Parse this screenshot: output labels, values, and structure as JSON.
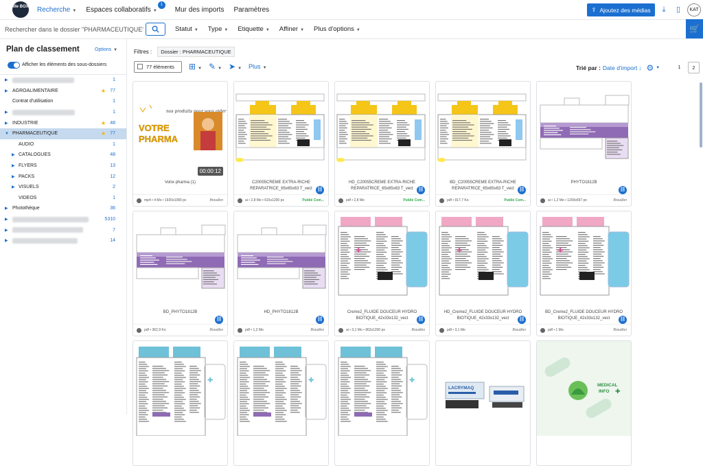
{
  "topnav": {
    "logo_text": "file BOX",
    "items": [
      {
        "label": "Recherche",
        "active": true,
        "caret": true
      },
      {
        "label": "Espaces collaboratifs",
        "active": false,
        "caret": true,
        "badge": "1"
      },
      {
        "label": "Mur des imports",
        "active": false,
        "caret": false
      },
      {
        "label": "Paramètres",
        "active": false,
        "caret": false
      }
    ],
    "add_media_label": "Ajoutez des médias",
    "avatar": "KAT",
    "accent_color": "#1b6fd0"
  },
  "searchbar": {
    "placeholder": "Rechercher dans le dossier \"PHARMACEUTIQUE\"",
    "filters": [
      "Statut",
      "Type",
      "Etiquette",
      "Affiner",
      "Plus d'options"
    ]
  },
  "sidebar": {
    "title": "Plan de classement",
    "options_label": "Options",
    "toggle_label": "Afficher les éléments des sous-dossiers",
    "nodes": [
      {
        "label": "",
        "count": "1",
        "blur": true,
        "arrow": true,
        "indent": 0
      },
      {
        "label": "AGROALIMENTAIRE",
        "count": "77",
        "star": true,
        "arrow": true,
        "indent": 0
      },
      {
        "label": "Contrat d'utilisation",
        "count": "1",
        "indent": 0
      },
      {
        "label": "",
        "count": "1",
        "blur": true,
        "arrow": true,
        "indent": 0
      },
      {
        "label": "INDUSTRIE",
        "count": "48",
        "star": true,
        "arrow": true,
        "indent": 0
      },
      {
        "label": "PHARMACEUTIQUE",
        "count": "77",
        "star": true,
        "arrow": true,
        "open": true,
        "selected": true,
        "indent": 0
      },
      {
        "label": "AUDIO",
        "count": "1",
        "indent": 1
      },
      {
        "label": "CATALOGUES",
        "count": "48",
        "arrow": true,
        "indent": 1
      },
      {
        "label": "FLYERS",
        "count": "13",
        "arrow": true,
        "indent": 1
      },
      {
        "label": "PACKS",
        "count": "12",
        "arrow": true,
        "indent": 1
      },
      {
        "label": "VISUELS",
        "count": "2",
        "arrow": true,
        "indent": 1
      },
      {
        "label": "VIDEOS",
        "count": "1",
        "indent": 1
      },
      {
        "label": "Photothèque",
        "count": "36",
        "arrow": true,
        "indent": 0
      },
      {
        "label": "",
        "count": "5310",
        "blur": true,
        "arrow": true,
        "indent": 0
      },
      {
        "label": "",
        "count": "7",
        "blur": true,
        "arrow": true,
        "indent": 0
      },
      {
        "label": "",
        "count": "14",
        "blur": true,
        "arrow": true,
        "indent": 0
      }
    ]
  },
  "main": {
    "filters_label": "Filtres :",
    "filter_chip": "Dossier : PHARMACEUTIQUE",
    "select_label": "77 éléments",
    "plus_label": "Plus",
    "sort_label": "Trié par :",
    "sort_value": "Date d'import",
    "pages": [
      "1",
      "2"
    ]
  },
  "cards": [
    {
      "title": "Votre pharma (1)",
      "meta": "mp4 • 4 Mo • 1920x1080 px",
      "status": "Brouillon",
      "published": false,
      "duration": "00:00:12",
      "kind": "video",
      "promo": "VOTRE PHARMA",
      "promo_sub": "nos produits pour vous aider",
      "link": false
    },
    {
      "title": "C20055CREME EXTRA-RICHE REPARATRICE_65x65x63 T_vect",
      "meta": "ai • 2,8 Mo • 615x1200 px",
      "status": "Publié Com...",
      "published": true,
      "kind": "yellow",
      "link": true
    },
    {
      "title": "HD_C20055CREME EXTRA-RICHE REPARATRICE_65x65x63 T_vect",
      "meta": "pdf • 2,8 Mo",
      "status": "Publié Com...",
      "published": true,
      "kind": "yellow",
      "link": true
    },
    {
      "title": "BD_C20055CREME EXTRA-RICHE REPARATRICE_65x65x63 T_vect",
      "meta": "pdf • 917,7 Ko",
      "status": "Publié Com...",
      "published": true,
      "kind": "yellow",
      "link": true
    },
    {
      "title": "PHYTO1812B",
      "meta": "ai • 1,2 Mo • 1200x657 px",
      "status": "Brouillon",
      "published": false,
      "kind": "purple",
      "link": true
    },
    {
      "title": "BD_PHYTO1812B",
      "meta": "pdf • 362,9 Ko",
      "status": "Brouillon",
      "published": false,
      "kind": "purple",
      "link": true
    },
    {
      "title": "HD_PHYTO1812B",
      "meta": "pdf • 1,2 Mo",
      "status": "Brouillon",
      "published": false,
      "kind": "purple",
      "link": true
    },
    {
      "title": "Creme2_FLUIDE DOUCEUR HYDRO BIOTIQUE_42x33x132_vect",
      "meta": "ai • 3,1 Mo • 963x1200 px",
      "status": "Brouillon",
      "published": false,
      "kind": "pink",
      "link": true
    },
    {
      "title": "HD_Creme2_FLUIDE DOUCEUR HYDRO BIOTIQUE_42x33x132_vect",
      "meta": "pdf • 3,1 Mo",
      "status": "Brouillon",
      "published": false,
      "kind": "pink",
      "link": true
    },
    {
      "title": "BD_Creme2_FLUIDE DOUCEUR HYDRO BIOTIQUE_42x33x132_vect",
      "meta": "pdf • 1 Mo",
      "status": "Brouillon",
      "published": false,
      "kind": "pink",
      "link": true
    },
    {
      "title": "",
      "meta": "",
      "status": "",
      "kind": "teal",
      "link": false
    },
    {
      "title": "",
      "meta": "",
      "status": "",
      "kind": "teal",
      "link": false
    },
    {
      "title": "",
      "meta": "",
      "status": "",
      "kind": "teal",
      "link": false
    },
    {
      "title": "",
      "meta": "",
      "status": "",
      "kind": "lacrymaq",
      "brand": "LACRYMAQ",
      "link": false
    },
    {
      "title": "",
      "meta": "",
      "status": "",
      "kind": "medical",
      "brand": "MEDICAL INFO",
      "link": false
    }
  ]
}
